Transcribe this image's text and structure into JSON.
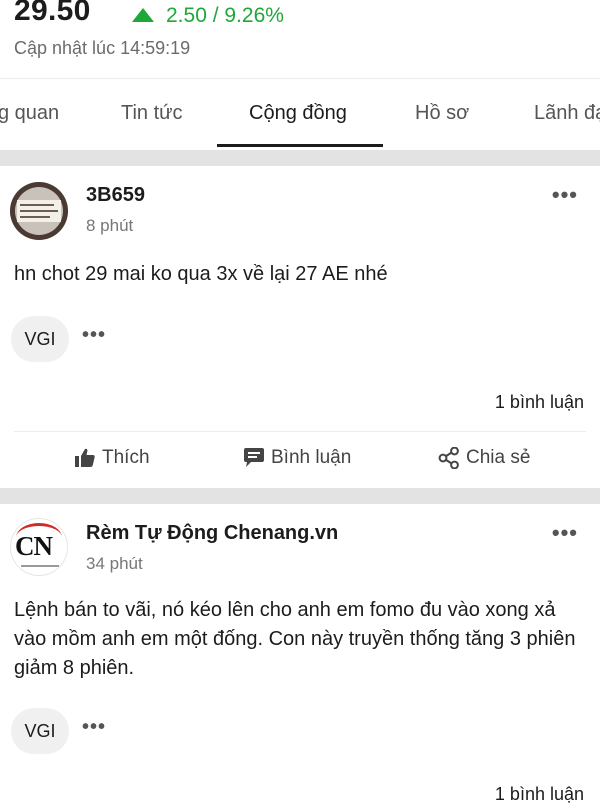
{
  "header": {
    "price": "29.50",
    "change": "2.50 / 9.26%",
    "updated": "Cập nhật lúc 14:59:19",
    "colors": {
      "up": "#1fa83a"
    }
  },
  "tabs": [
    {
      "label": "Tổng quan",
      "visible_text": "g quan"
    },
    {
      "label": "Tin tức",
      "visible_text": "Tin tức"
    },
    {
      "label": "Cộng đồng",
      "visible_text": "Cộng đồng",
      "active": true
    },
    {
      "label": "Hồ sơ",
      "visible_text": "Hồ sơ"
    },
    {
      "label": "Lãnh đạo",
      "visible_text": "Lãnh đạ"
    }
  ],
  "posts": [
    {
      "author": "3B659",
      "time": "8 phút",
      "content": "hn chot 29 mai ko qua 3x về lại 27 AE nhé",
      "ticker": "VGI",
      "comments": "1 bình luận"
    },
    {
      "author": "Rèm Tự Động Chenang.vn",
      "avatar_text": "CN",
      "time": "34 phút",
      "content": "Lệnh bán to vãi, nó kéo lên cho anh em fomo đu vào xong xả vào mồm anh em một đống. Con này truyền thống tăng 3 phiên giảm 8 phiên.",
      "ticker": "VGI",
      "comments": "1 bình luận"
    }
  ],
  "actions": {
    "like": "Thích",
    "comment": "Bình luận",
    "share": "Chia sẻ"
  },
  "icons": {
    "more": "•••",
    "up_arrow": "triangle-up-icon",
    "like": "thumbs-up-icon",
    "comment": "chat-bubble-icon",
    "share": "share-icon"
  }
}
